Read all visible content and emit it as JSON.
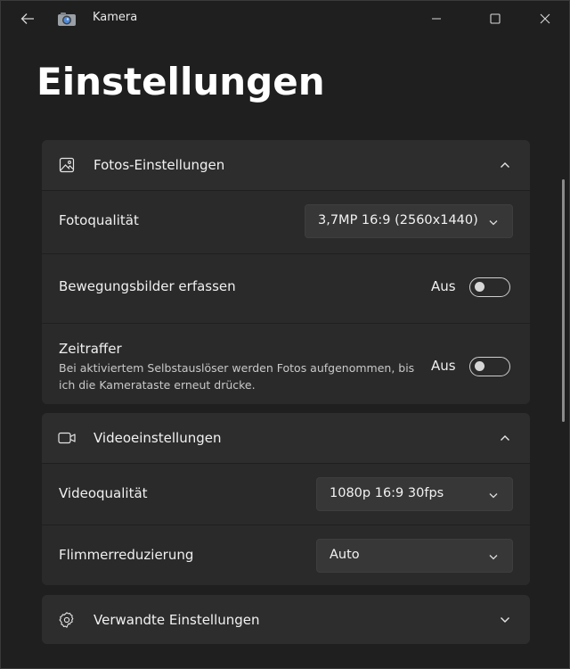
{
  "window": {
    "app_title": "Kamera"
  },
  "page": {
    "title": "Einstellungen"
  },
  "photo_section": {
    "header": "Fotos-Einstellungen",
    "photo_quality": {
      "label": "Fotoqualität",
      "value": "3,7MP 16:9 (2560x1440)"
    },
    "motion_pictures": {
      "label": "Bewegungsbilder erfassen",
      "state": "Aus"
    },
    "timelapse": {
      "label": "Zeitraffer",
      "description": "Bei aktiviertem Selbstauslöser werden Fotos aufgenommen, bis ich die Kamerataste erneut drücke.",
      "state": "Aus"
    }
  },
  "video_section": {
    "header": "Videoeinstellungen",
    "video_quality": {
      "label": "Videoqualität",
      "value": "1080p 16:9 30fps"
    },
    "flicker_reduction": {
      "label": "Flimmerreduzierung",
      "value": "Auto"
    }
  },
  "related_section": {
    "header": "Verwandte Einstellungen"
  },
  "colors": {
    "background": "#1f1f1f",
    "card": "#2b2b2b",
    "select": "#373737",
    "text": "#ffffff"
  },
  "icons": [
    "back-arrow-icon",
    "camera-app-icon",
    "minimize-icon",
    "maximize-icon",
    "close-icon",
    "image-icon",
    "video-camera-icon",
    "gear-icon",
    "chevron-up-icon",
    "chevron-down-icon"
  ]
}
